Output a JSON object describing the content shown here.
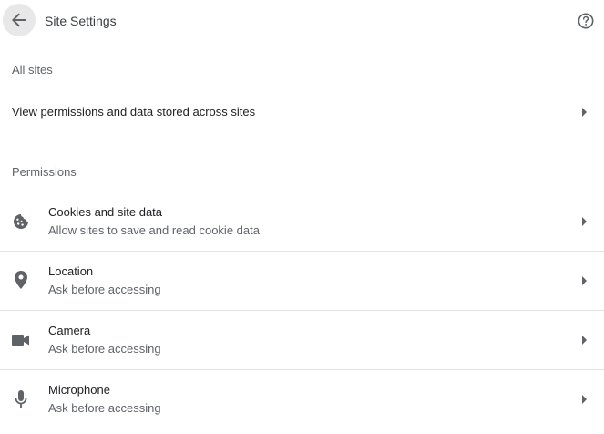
{
  "header": {
    "title": "Site Settings",
    "back_icon": "arrow-back-icon",
    "help_icon": "help-circle-icon"
  },
  "all_sites": {
    "heading": "All sites",
    "view_permissions_label": "View permissions and data stored across sites"
  },
  "permissions": {
    "heading": "Permissions",
    "items": [
      {
        "label": "Cookies and site data",
        "sub": "Allow sites to save and read cookie data",
        "icon": "cookie-icon"
      },
      {
        "label": "Location",
        "sub": "Ask before accessing",
        "icon": "location-pin-icon"
      },
      {
        "label": "Camera",
        "sub": "Ask before accessing",
        "icon": "camera-icon"
      },
      {
        "label": "Microphone",
        "sub": "Ask before accessing",
        "icon": "microphone-icon"
      }
    ]
  },
  "colors": {
    "icon": "#5f6368",
    "text_primary": "#202124",
    "text_secondary": "#5f6368",
    "divider": "#e4e4e4"
  }
}
